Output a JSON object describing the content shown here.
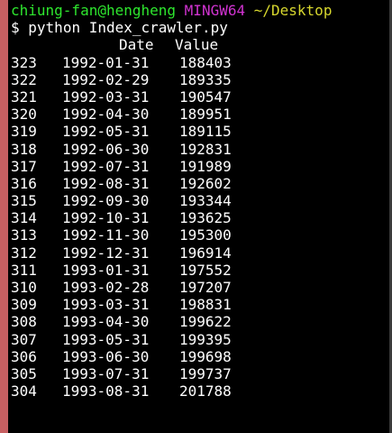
{
  "prompt": {
    "user_host": "chiung-fan@hengheng",
    "shell": "MINGW64",
    "path": "~/Desktop",
    "symbol": "$",
    "command": "python Index_crawler.py"
  },
  "table": {
    "columns": [
      "Date",
      "Value"
    ],
    "rows": [
      {
        "index": "323",
        "date": "1992-01-31",
        "value": "188403"
      },
      {
        "index": "322",
        "date": "1992-02-29",
        "value": "189335"
      },
      {
        "index": "321",
        "date": "1992-03-31",
        "value": "190547"
      },
      {
        "index": "320",
        "date": "1992-04-30",
        "value": "189951"
      },
      {
        "index": "319",
        "date": "1992-05-31",
        "value": "189115"
      },
      {
        "index": "318",
        "date": "1992-06-30",
        "value": "192831"
      },
      {
        "index": "317",
        "date": "1992-07-31",
        "value": "191989"
      },
      {
        "index": "316",
        "date": "1992-08-31",
        "value": "192602"
      },
      {
        "index": "315",
        "date": "1992-09-30",
        "value": "193344"
      },
      {
        "index": "314",
        "date": "1992-10-31",
        "value": "193625"
      },
      {
        "index": "313",
        "date": "1992-11-30",
        "value": "195300"
      },
      {
        "index": "312",
        "date": "1992-12-31",
        "value": "196914"
      },
      {
        "index": "311",
        "date": "1993-01-31",
        "value": "197552"
      },
      {
        "index": "310",
        "date": "1993-02-28",
        "value": "197207"
      },
      {
        "index": "309",
        "date": "1993-03-31",
        "value": "198831"
      },
      {
        "index": "308",
        "date": "1993-04-30",
        "value": "199622"
      },
      {
        "index": "307",
        "date": "1993-05-31",
        "value": "199395"
      },
      {
        "index": "306",
        "date": "1993-06-30",
        "value": "199698"
      },
      {
        "index": "305",
        "date": "1993-07-31",
        "value": "199737"
      },
      {
        "index": "304",
        "date": "1993-08-31",
        "value": "201788"
      }
    ]
  },
  "colors": {
    "background": "#000000",
    "text": "#ffffff",
    "user_host": "#2ee62e",
    "shell": "#d133d1",
    "path": "#d7d72e",
    "window_left_border": "#c75f61"
  }
}
